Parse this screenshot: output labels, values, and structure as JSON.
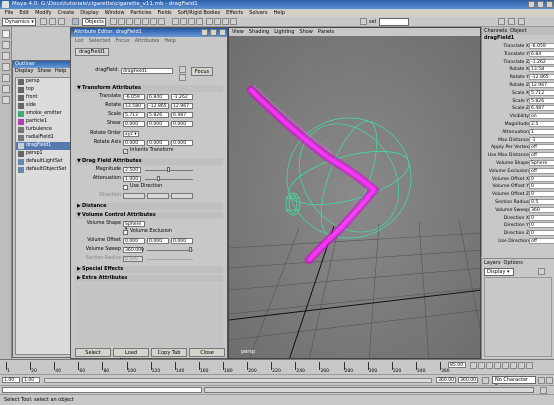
{
  "window": {
    "title": "Maya 4.0: G:\\Docs\\tutorials\\cigarette\\cigarette_v11.mb  -  dragField1"
  },
  "menubar": [
    "File",
    "Edit",
    "Modify",
    "Create",
    "Display",
    "Window",
    "Particles",
    "Fields",
    "Soft/Rigid Bodies",
    "Effects",
    "Solvers",
    "Help"
  ],
  "statusline": {
    "module": "Dynamics",
    "objects_label": "Objects",
    "sel_label": "sel"
  },
  "outliner": {
    "title": "Outliner",
    "menu": [
      "Display",
      "Show",
      "Help"
    ],
    "items": [
      {
        "name": "persp",
        "selected": false
      },
      {
        "name": "top",
        "selected": false
      },
      {
        "name": "front",
        "selected": false
      },
      {
        "name": "side",
        "selected": false
      },
      {
        "name": "smoke_emitter",
        "selected": false
      },
      {
        "name": "particle1",
        "selected": false
      },
      {
        "name": "turbulence",
        "selected": false
      },
      {
        "name": "radialField1",
        "selected": false
      },
      {
        "name": "dragField1",
        "selected": true
      },
      {
        "name": "persp1",
        "selected": false
      },
      {
        "name": "defaultLightSet",
        "selected": false
      },
      {
        "name": "defaultObjectSet",
        "selected": false
      }
    ]
  },
  "attribute_editor": {
    "title": "Attribute Editor: dragField1",
    "menu": [
      "List",
      "Selected",
      "Focus",
      "Attributes",
      "Help"
    ],
    "tab": "dragField1",
    "node_label": "dragField:",
    "node_value": "dragField1",
    "focus_button": "Focus",
    "transform": {
      "title": "Transform Attributes",
      "translate": {
        "label": "Translate",
        "values": [
          "-6.059",
          "6.840",
          "-1.262"
        ]
      },
      "rotate": {
        "label": "Rotate",
        "values": [
          "13.580",
          "-12.865",
          "12.967"
        ]
      },
      "scale": {
        "label": "Scale",
        "values": [
          "5.712",
          "5.826",
          "6.487"
        ]
      },
      "shear": {
        "label": "Shear",
        "values": [
          "0.000",
          "0.000",
          "0.000"
        ]
      },
      "rotate_order": {
        "label": "Rotate Order",
        "value": "xyz"
      },
      "rotate_axis": {
        "label": "Rotate Axis",
        "values": [
          "0.000",
          "0.000",
          "0.000"
        ]
      },
      "inherits_transform": "Inherits Transform"
    },
    "drag": {
      "title": "Drag Field Attributes",
      "magnitude": {
        "label": "Magnitude",
        "value": "2.500"
      },
      "attenuation": {
        "label": "Attenuation",
        "value": "1.000"
      },
      "use_direction": "Use Direction",
      "direction_label": "Direction"
    },
    "distance_title": "Distance",
    "volume": {
      "title": "Volume Control Attributes",
      "shape": {
        "label": "Volume Shape",
        "value": "Sphere"
      },
      "exclusion": "Volume Exclusion",
      "offset": {
        "label": "Volume Offset",
        "values": [
          "0.000",
          "0.000",
          "0.000"
        ]
      },
      "sweep": {
        "label": "Volume Sweep",
        "value": "360.000"
      },
      "section_radius": {
        "label": "Section Radius",
        "value": "0.500"
      }
    },
    "special_effects": "Special Effects",
    "extra_attributes": "Extra Attributes",
    "buttons": [
      "Select",
      "Load Attributes",
      "Copy Tab",
      "Close"
    ]
  },
  "viewport": {
    "menu": [
      "View",
      "Shading",
      "Lighting",
      "Show",
      "Panels"
    ],
    "camera_label": "persp"
  },
  "channel_box": {
    "tabs": [
      "Channels",
      "Object"
    ],
    "node": "dragField1",
    "rows": [
      {
        "label": "Translate X",
        "value": "-6.059"
      },
      {
        "label": "Translate Y",
        "value": "6.84"
      },
      {
        "label": "Translate Z",
        "value": "-1.262"
      },
      {
        "label": "Rotate X",
        "value": "13.58"
      },
      {
        "label": "Rotate Y",
        "value": "-12.865"
      },
      {
        "label": "Rotate Z",
        "value": "12.967"
      },
      {
        "label": "Scale X",
        "value": "5.712"
      },
      {
        "label": "Scale Y",
        "value": "5.826"
      },
      {
        "label": "Scale Z",
        "value": "6.487"
      },
      {
        "label": "Visibility",
        "value": "on"
      },
      {
        "label": "Magnitude",
        "value": "2.5"
      },
      {
        "label": "Attenuation",
        "value": "1"
      },
      {
        "label": "Max Distance",
        "value": "-1"
      },
      {
        "label": "Apply Per Vertex",
        "value": "off"
      },
      {
        "label": "Use Max Distance",
        "value": "off"
      },
      {
        "label": "Volume Shape",
        "value": "Sphere"
      },
      {
        "label": "Volume Exclusion",
        "value": "off"
      },
      {
        "label": "Volume Offset X",
        "value": "0"
      },
      {
        "label": "Volume Offset Y",
        "value": "0"
      },
      {
        "label": "Volume Offset Z",
        "value": "0"
      },
      {
        "label": "Section Radius",
        "value": "0.5"
      },
      {
        "label": "Volume Sweep",
        "value": "360"
      },
      {
        "label": "Direction X",
        "value": "0"
      },
      {
        "label": "Direction Y",
        "value": "0"
      },
      {
        "label": "Direction Z",
        "value": "0"
      },
      {
        "label": "Use Direction",
        "value": "off"
      }
    ]
  },
  "layers": {
    "tabs": [
      "Layers",
      "Options"
    ],
    "dropdown": "Display"
  },
  "timeline": {
    "ticks": [
      "1",
      "20",
      "40",
      "60",
      "80",
      "100",
      "120",
      "140",
      "160",
      "180",
      "200",
      "220",
      "240",
      "260",
      "280",
      "300",
      "320",
      "340",
      "360"
    ],
    "current_frame": "85.00"
  },
  "range": {
    "start": "1.00",
    "inner_start": "1.00",
    "inner_end": "360.00",
    "end": "360.00",
    "character": "No Character Se"
  },
  "help_line": "Select Tool: select an object"
}
